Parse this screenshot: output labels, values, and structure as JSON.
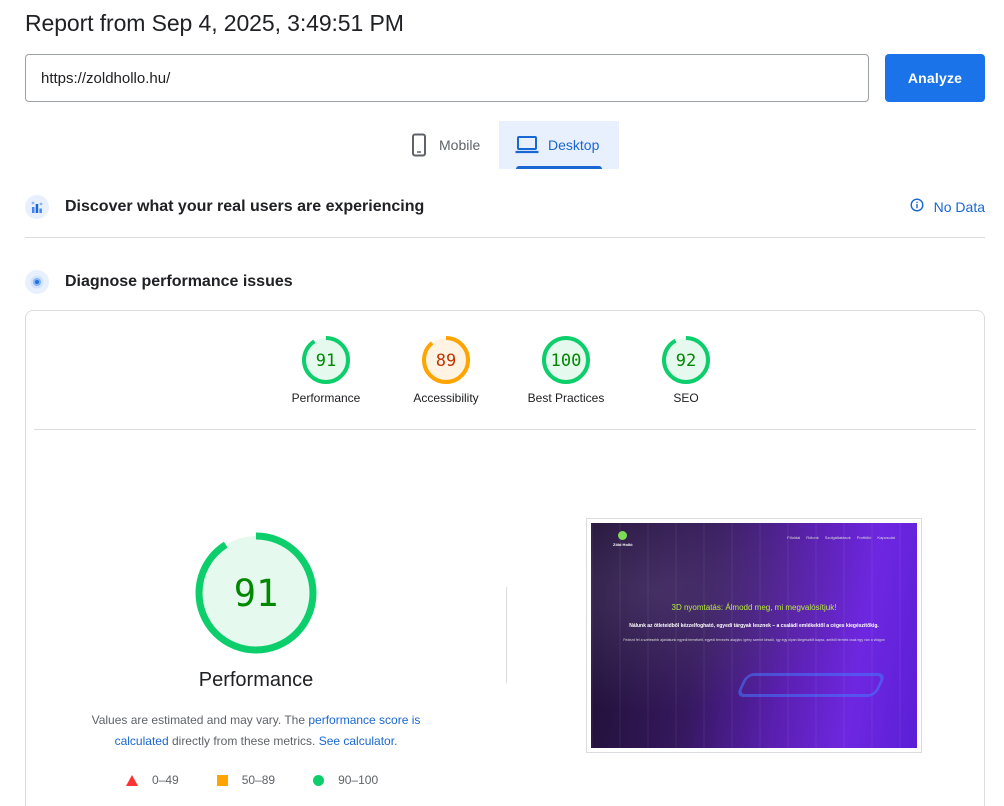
{
  "report": {
    "title": "Report from Sep 4, 2025, 3:49:51 PM"
  },
  "url_input": {
    "value": "https://zoldhollo.hu/"
  },
  "analyze_button": {
    "label": "Analyze"
  },
  "device_tabs": [
    {
      "label": "Mobile",
      "icon": "phone-icon",
      "selected": false
    },
    {
      "label": "Desktop",
      "icon": "laptop-icon",
      "selected": true
    }
  ],
  "real_users": {
    "title": "Discover what your real users are experiencing",
    "status": "No Data",
    "icon": "crux-icon"
  },
  "diagnose": {
    "title": "Diagnose performance issues",
    "icon": "lighthouse-icon"
  },
  "scores": [
    {
      "label": "Performance",
      "value": "91",
      "status": "pass"
    },
    {
      "label": "Accessibility",
      "value": "89",
      "status": "average"
    },
    {
      "label": "Best Practices",
      "value": "100",
      "status": "pass"
    },
    {
      "label": "SEO",
      "value": "92",
      "status": "pass"
    }
  ],
  "main_score": {
    "value": "91",
    "title": "Performance",
    "desc_before": "Values are estimated and may vary. The ",
    "desc_link1": "performance score is calculated",
    "desc_middle": " directly from these metrics. ",
    "desc_link2": "See calculator."
  },
  "legend": [
    {
      "label": "0–49",
      "shape": "triangle",
      "color": "#ff3333"
    },
    {
      "label": "50–89",
      "shape": "square",
      "color": "#ffa400"
    },
    {
      "label": "90–100",
      "shape": "circle",
      "color": "#0cce6b"
    }
  ],
  "screenshot": {
    "logo_text": "Zöld Holló",
    "nav": [
      "Főoldal",
      "Rólunk",
      "Szolgáltatások",
      "Portfólió",
      "Kapcsolat"
    ],
    "headline": "3D nyomtatás: Álmodd meg, mi megvalósítjuk!",
    "subheadline": "Nálunk az ötleteidből kézzelfogható, egyedi tárgyak lesznek – a családi emlékektől a céges kiegészítőkig.",
    "paragraph": "Fedezd fel a szélesebb ajánlatunk egyedi termékeit, egyedi tervezés alapján, igény szerint készül, így egy olyan kiegészítőt kapsz, amiből termék csak egy van a világon"
  },
  "colors": {
    "accent": "#1a73e8",
    "pass": "#0cce6b",
    "pass_text": "#008800",
    "average": "#ffa400",
    "average_text": "#c33300",
    "fail": "#ff3333"
  }
}
